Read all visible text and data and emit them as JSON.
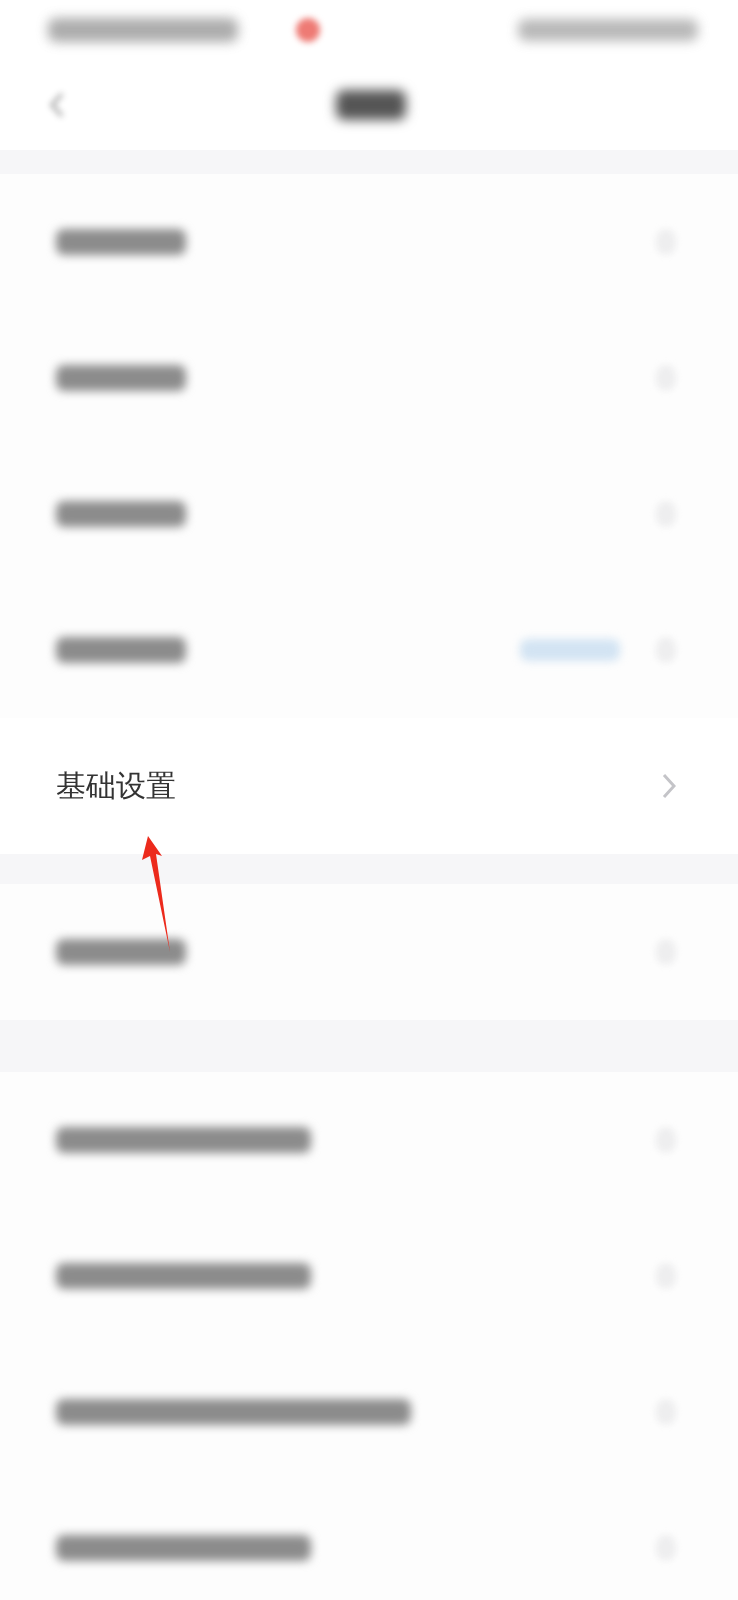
{
  "sections": [
    {
      "rows": [
        {
          "kind": "blurred",
          "tag": false
        },
        {
          "kind": "blurred",
          "tag": false
        },
        {
          "kind": "blurred",
          "tag": false
        },
        {
          "kind": "blurred",
          "tag": true
        },
        {
          "kind": "item",
          "label": "基础设置"
        }
      ]
    },
    {
      "rows": [
        {
          "kind": "blurred",
          "tag": false
        }
      ]
    },
    {
      "rows": [
        {
          "kind": "blurredlong",
          "tag": false
        },
        {
          "kind": "blurredlong",
          "tag": false
        },
        {
          "kind": "blurredlonger",
          "tag": false
        },
        {
          "kind": "blurredlong",
          "tag": false
        }
      ]
    }
  ]
}
